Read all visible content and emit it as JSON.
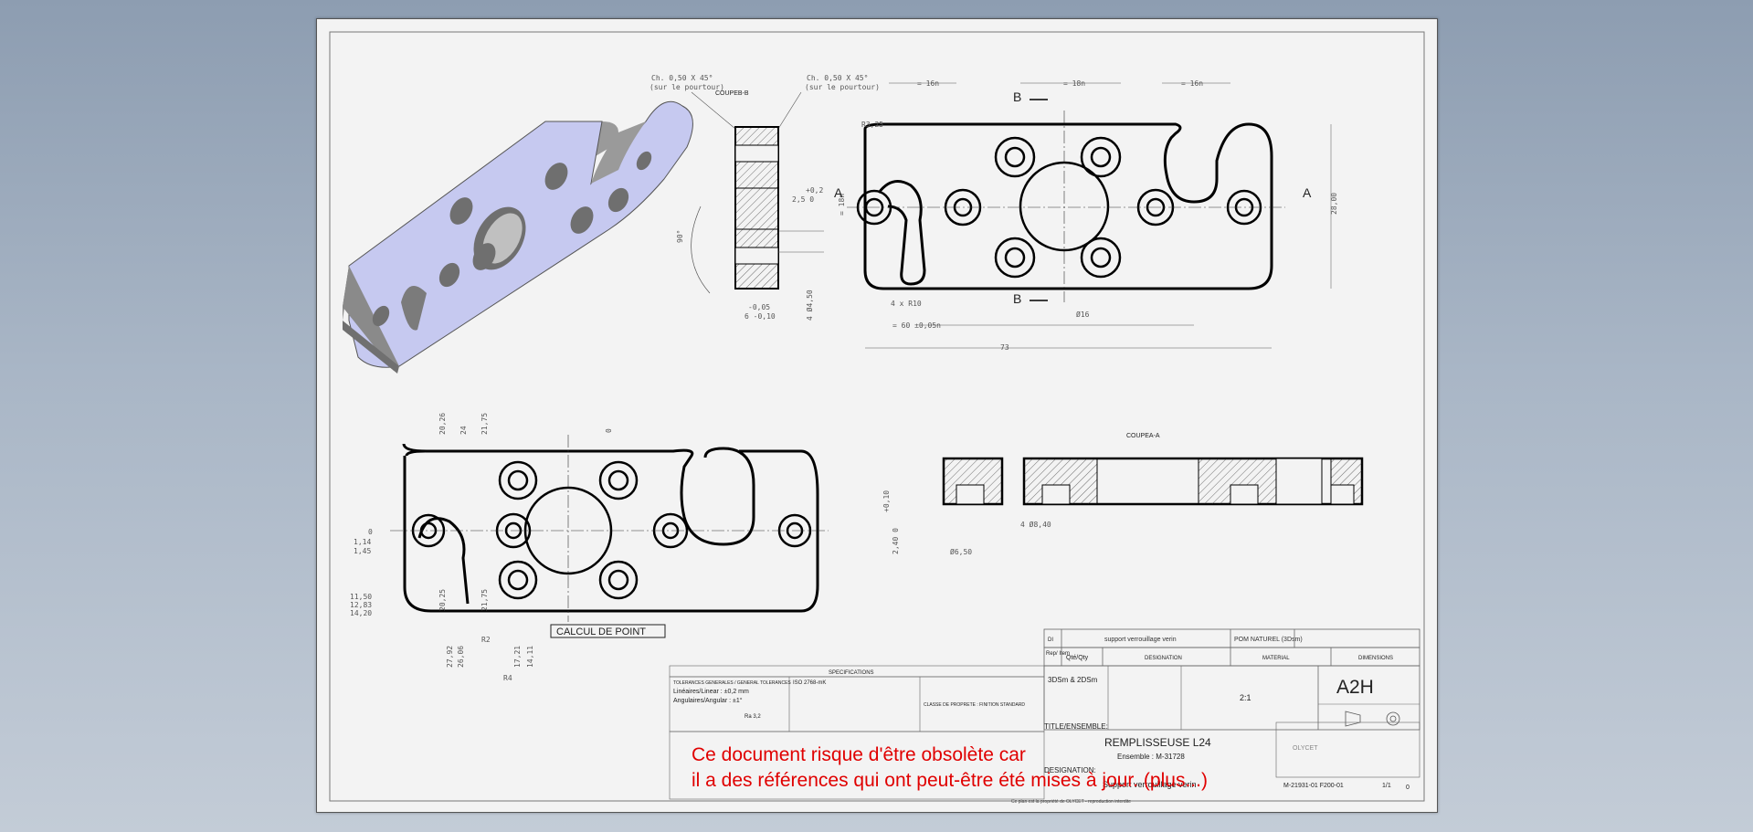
{
  "drawing": {
    "section_b_title": "COUPEB-B",
    "section_a_title": "COUPEA-A",
    "chamfer_note_1": "Ch. 0,50 X 45°",
    "chamfer_note_1b": "(sur le pourtour)",
    "chamfer_note_2": "Ch. 0,50 X 45°",
    "chamfer_note_2b": "(sur le pourtour)",
    "calc_label": "CALCUL DE POINT",
    "marker_a": "A",
    "marker_b": "B",
    "dims": {
      "d16a": "= 16n",
      "d18": "= 18n",
      "d16b": "= 16n",
      "r325": "R3,25",
      "r10": "4 x R10",
      "d16": "Ø16",
      "d60": "= 60 ±0,05n",
      "d73": "73",
      "d18v": "= 18n",
      "d28": "28,00",
      "angle": "90°",
      "tol": "+0,2",
      "tol2": "2,5 0",
      "tol3": "-0,05",
      "tol4": "6 -0,10",
      "d450": "4 Ø4,50",
      "d840": "4 Ø8,40",
      "d650": "Ø6,50",
      "d010": "+0,10",
      "d240": "2,40 0",
      "v2026": "20,26",
      "v24": "24",
      "v2175": "21,75",
      "v0top": "0",
      "y0": "0",
      "y114": "1,14",
      "y145": "1,45",
      "y1150": "11,50",
      "y1283": "12,83",
      "y1420": "14,20",
      "v2025": "20,25",
      "v2175b": "21,75",
      "v2792": "27,92",
      "v2606": "26,06",
      "v1721": "17,21",
      "v1411": "14,11",
      "r2": "R2",
      "r4": "R4"
    }
  },
  "title_block": {
    "specifications": "SPECIFICATIONS",
    "general_tolerances": "TOLERANCES GENERALES / GENERAL TOLERANCES",
    "lin_tol": "Linéaires/Linear : ±0,2 mm",
    "ang_tol": "Angulaires/Angular : ±1°",
    "ra": "Ra 3,2",
    "scale_note": "ISO 2768-mK",
    "class_note": "CLASSE DE PROPRETE : FINITION STANDARD",
    "row_di": "DI",
    "row_support": "support verrouillage verin",
    "row_pom": "POM NATUREL (3Dsm)",
    "col_rep": "Rep/ Item",
    "col_qte": "Qté/Qty",
    "col_designation": "DESIGNATION",
    "col_material": "MATERIAL",
    "col_dimensions": "DIMENSIONS",
    "date1": "3DSm & 2DSm",
    "scale": "2:1",
    "format": "A2H",
    "title_label": "TITLE/ENSEMBLE:",
    "title_value": "REMPLISSEUSE L24",
    "ensemble_value": "Ensemble : M-31728",
    "designation_label": "DESIGNATION:",
    "designation_value": "Support verrouillage verin",
    "part_number": "M-21931-01 F200-01",
    "sheet": "1/1",
    "rev": "0",
    "company": "OLYCET",
    "footer": "Ce plan est la propriété de OLYCET - reproduction interdite"
  },
  "warning": {
    "line1": "Ce document risque d'être obsolète car",
    "line2": "il a des références qui ont peut-être été mises à jour. (plus...)"
  },
  "colors": {
    "background": "#9fadbf",
    "sheet": "#f3f3f3",
    "part_face": "#c6c9f0",
    "warning": "#e00000"
  }
}
